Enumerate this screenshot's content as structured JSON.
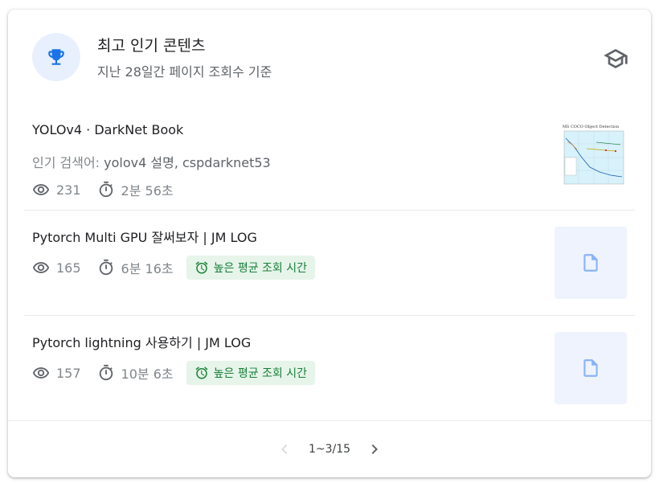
{
  "header": {
    "title": "최고 인기 콘텐츠",
    "subtitle": "지난 28일간 페이지 조회수 기준",
    "trophy_icon": "trophy-icon",
    "cap_icon": "school-icon",
    "accent": "#1a73e8"
  },
  "items": [
    {
      "title": "YOLOv4 · DarkNet Book",
      "keywords_label": "인기 검색어: ",
      "keywords_value": "yolov4 설명, cspdarknet53",
      "views": "231",
      "duration": "2분 56초",
      "thumbnail": "chart-thumbnail",
      "thumbnail_title": "MS COCO Object Detection"
    },
    {
      "title": "Pytorch Multi GPU 잘써보자 | JM LOG",
      "views": "165",
      "duration": "6분 16초",
      "badge": "높은 평균 조회 시간",
      "thumbnail": "document-icon"
    },
    {
      "title": "Pytorch lightning 사용하기 | JM LOG",
      "views": "157",
      "duration": "10분 6초",
      "badge": "높은 평균 조회 시간",
      "thumbnail": "document-icon"
    }
  ],
  "pagination": {
    "range": "1~3/15",
    "prev_icon": "chevron-left-icon",
    "next_icon": "chevron-right-icon"
  },
  "colors": {
    "badge_bg": "#e6f4ea",
    "badge_text": "#188038",
    "thumb_bg": "#eef3fd",
    "doc_icon": "#8ab4f8"
  }
}
